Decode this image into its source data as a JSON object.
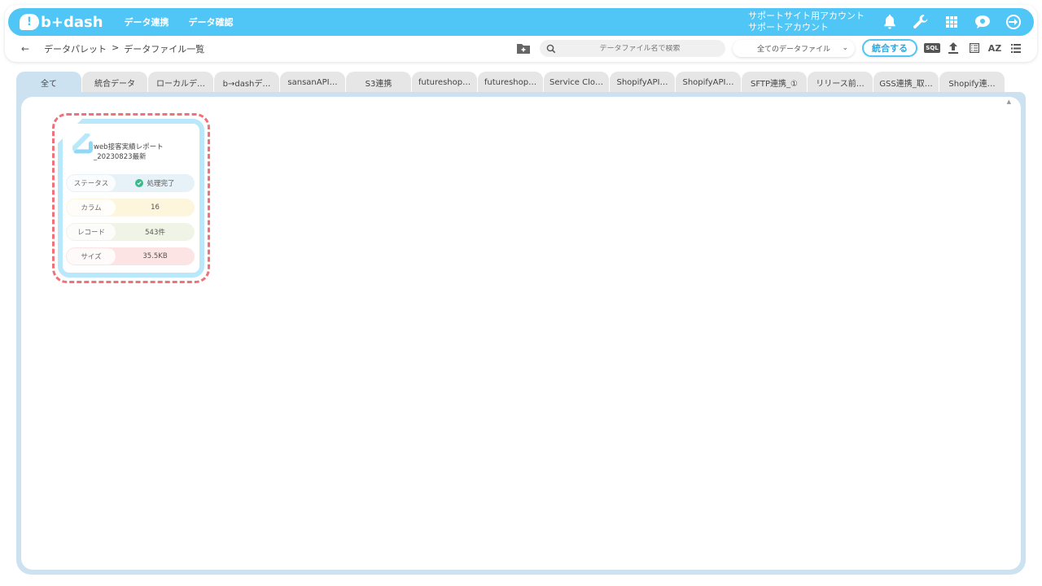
{
  "header": {
    "logo_mark": "!",
    "logo_text": "b+dash",
    "nav": [
      "データ連携",
      "データ確認"
    ],
    "account_line1": "サポートサイト用アカウント",
    "account_line2": "サポートアカウント",
    "accent_color": "#4fc6f5",
    "icons": [
      "bell-icon",
      "wrench-icon",
      "grid-icon",
      "profile-icon",
      "logout-icon"
    ]
  },
  "subbar": {
    "back": "←",
    "breadcrumb": [
      "データパレット",
      ">",
      "データファイル一覧"
    ],
    "search_placeholder": "データファイル名で検索",
    "filter_value": "全てのデータファイル",
    "merge_label": "統合する",
    "sql_label": "SQL",
    "az_label": "AZ"
  },
  "tabs": [
    "全て",
    "統合データ",
    "ローカルデ…",
    "b→dashデ…",
    "sansanAPI…",
    "S3連携",
    "futureshop…",
    "futureshop…",
    "Service Clo…",
    "ShopifyAPI…",
    "ShopifyAPI…",
    "SFTP連携_①",
    "リリース前…",
    "GSS連携_取…",
    "Shopify連…"
  ],
  "active_tab": 0,
  "card": {
    "file_name": "web接客実績レポート_20230823最新",
    "rows": [
      {
        "label": "ステータス",
        "value": "処理完了",
        "color": "#e6f1f8"
      },
      {
        "label": "カラム",
        "value": "16",
        "color": "#fdf5dc"
      },
      {
        "label": "レコード",
        "value": "543件",
        "color": "#f0f4e6"
      },
      {
        "label": "サイズ",
        "value": "35.5KB",
        "color": "#fce4e4"
      }
    ]
  }
}
